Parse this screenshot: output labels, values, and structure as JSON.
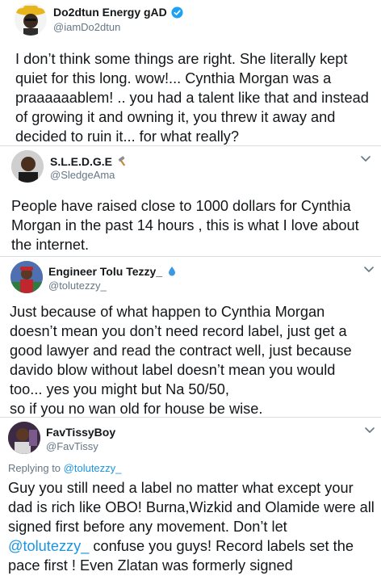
{
  "tweets": [
    {
      "name": "Do2dtun Energy gAD",
      "handle": "@iamDo2dtun",
      "verified": true,
      "lines": [
        "I don’t think some things are right. She literally kept",
        "quiet for this long. wow!... Cynthia Morgan was a",
        "praaaaaablem! .. you had a talent like that and instead",
        "of growing it and owning it, you threw it away and",
        "decided to ruin it... for what really?"
      ]
    },
    {
      "name": "S.L.E.D.G.E",
      "name_emoji": "hammer-icon",
      "handle": "@SledgeAma",
      "lines": [
        "People have raised close to 1000 dollars for Cynthia",
        "Morgan in the past 14 hours , this is what I love about",
        "the internet."
      ]
    },
    {
      "name": "Engineer Tolu Tezzy_",
      "name_emoji": "droplet-icon",
      "handle": "@tolutezzy_",
      "lines": [
        "Just because of what happen to  Cynthia Morgan",
        "doesn’t mean you don’t need record label, just get a",
        "good lawyer and read the contract well, just because",
        "davido blow without label doesn’t mean you would",
        "too... yes you might but Na 50/50,",
        "so if you no wan old for house be wise."
      ]
    },
    {
      "name": "FavTissyBoy",
      "handle": "@FavTissy",
      "replying_prefix": "Replying to ",
      "replying_handle": "@tolutezzy_",
      "lines": [
        "Guy you still need a label no matter what except your",
        "dad is rich like OBO! Burna,Wizkid and Olamide were all",
        "signed first before any movement. Don’t let",
        "confuse you guys! Record labels set the",
        "pace first ! Even Zlatan was formerly signed"
      ],
      "mention_in_line4": "@tolutezzy_"
    }
  ],
  "colors": {
    "verified": "#1da1f2",
    "link": "#1b95e0",
    "muted": "#657786",
    "divider": "#d8dde2"
  }
}
